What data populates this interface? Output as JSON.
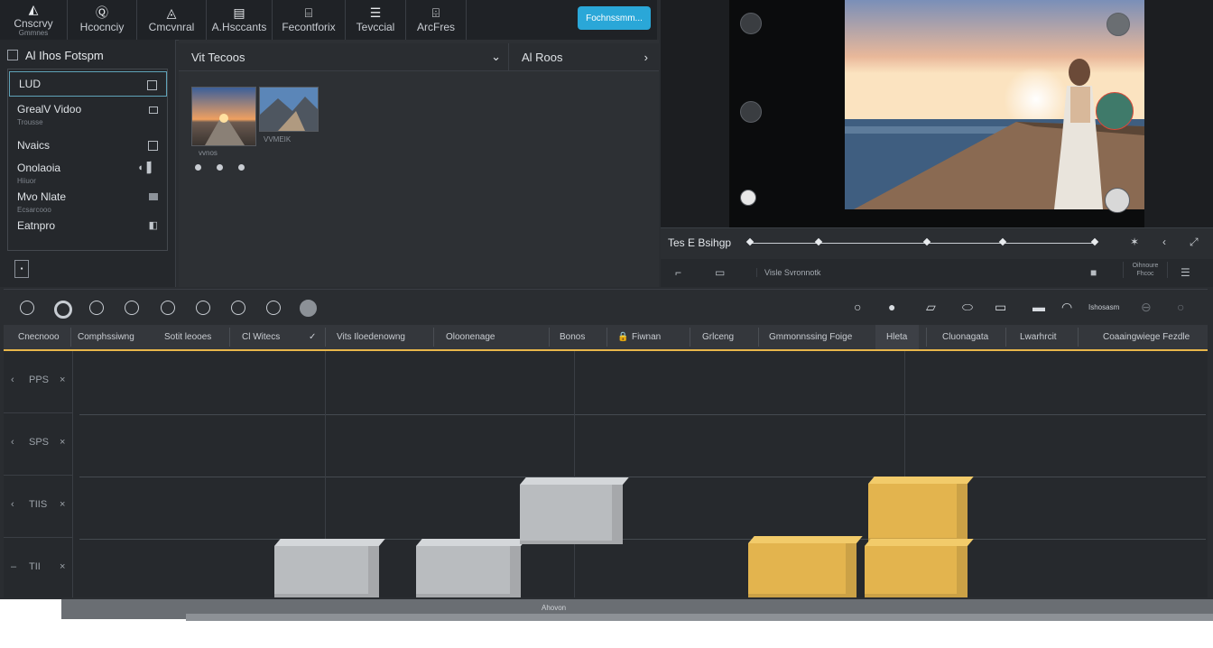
{
  "toolbar": {
    "tools": [
      {
        "icon": "◭",
        "label": "Cnscrvy",
        "sub": "Gmmnes"
      },
      {
        "icon": "Ⓠ",
        "label": "Hcocnciy"
      },
      {
        "icon": "◬",
        "label": "Cmcvnral"
      },
      {
        "icon": "▤",
        "label": "A.Hsccants"
      },
      {
        "icon": "⌸",
        "label": "Fecontforix"
      },
      {
        "icon": "☰",
        "label": "Tevccial"
      },
      {
        "icon": "⌹",
        "label": "ArcFres"
      }
    ],
    "primary_button": "Fochnssmm..."
  },
  "left_panel": {
    "title": "Al Ihos Fotspm",
    "items": [
      {
        "label": "LUD",
        "sub": ""
      },
      {
        "label": "GrealV Vidoo",
        "sub": "Trousse"
      },
      {
        "label": "Nvaics",
        "sub": ""
      },
      {
        "label": "Onolaoia",
        "sub": "Hiiuor"
      },
      {
        "label": "Mvo Nlate",
        "sub": "Ecsarcooo"
      },
      {
        "label": "Eatnpro",
        "sub": ""
      }
    ]
  },
  "media_panel": {
    "dropdown_label": "Vit Tecoos",
    "dropdown2_label": "Al Roos",
    "thumb_caption_1": "vvnos",
    "thumb_caption_2": "VVMEIK"
  },
  "preview": {
    "timeline_label": "Tes E Bsihgp"
  },
  "preview_subbar": {
    "text": "Visle Svronnotk",
    "right_line1": "Oihnoure",
    "right_line2": "Fhcoc"
  },
  "timeline_tools": {
    "right_text": "Ishosasm"
  },
  "track_header": {
    "columns": [
      "Cnecnooo",
      "Comphssiwng",
      "Sotit leooes",
      "Cl Witecs",
      "Vits Iloedenowng",
      "Oloonenage",
      "Bonos",
      "Fiwnan",
      "Grlceng",
      "Gmmonnssing Foige",
      "Hleta",
      "Cluonagata",
      "Lwarhrcit",
      "Coaaingwiege Fezdle"
    ]
  },
  "tracks": {
    "labels": [
      "PPS",
      "SPS",
      "TIIS",
      "TII"
    ],
    "footer": "Ahovon"
  },
  "colors": {
    "accent_button": "#2aa7d8",
    "playhead_line": "#e8b64a",
    "block_gray": "#b9bcbf",
    "block_yellow": "#e3b44e"
  }
}
